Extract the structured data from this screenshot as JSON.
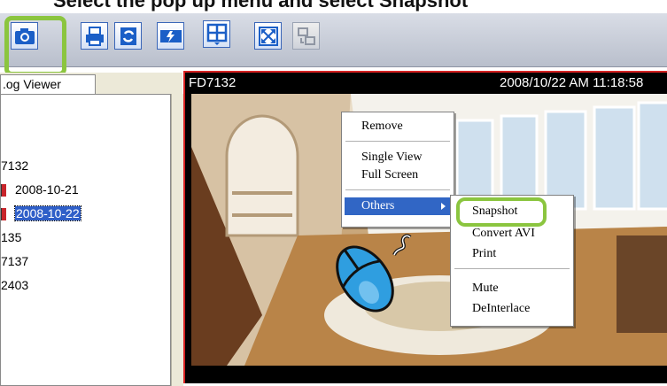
{
  "caption_fragment": "Select the pop up menu and select Snapshot",
  "toolbar": {
    "buttons": [
      {
        "name": "snapshot-button",
        "icon": "camera-icon"
      },
      {
        "name": "print-button",
        "icon": "printer-icon"
      },
      {
        "name": "refresh-button",
        "icon": "refresh-icon"
      },
      {
        "name": "lightning-button",
        "icon": "lightning-icon"
      },
      {
        "name": "layout-button",
        "icon": "grid-layout-icon"
      },
      {
        "name": "fullscreen-button",
        "icon": "fullscreen-icon"
      },
      {
        "name": "switch-disabled-button",
        "icon": "switch-icon"
      }
    ],
    "highlight_color": "#8bc53f"
  },
  "left_panel": {
    "tab_label": ".og Viewer",
    "items": [
      {
        "label": "7132",
        "icon": false,
        "selected": false
      },
      {
        "label": "2008-10-21",
        "icon": true,
        "selected": false
      },
      {
        "label": "2008-10-22",
        "icon": true,
        "selected": true
      },
      {
        "label": "135",
        "icon": false,
        "selected": false
      },
      {
        "label": "7137",
        "icon": false,
        "selected": false
      },
      {
        "label": "2403",
        "icon": false,
        "selected": false
      }
    ]
  },
  "video": {
    "camera_name": "FD7132",
    "timestamp": "2008/10/22 AM 11:18:58",
    "border_color": "#d62222"
  },
  "context_menu": {
    "remove": "Remove",
    "single_view": "Single View",
    "full_screen": "Full Screen",
    "others": "Others"
  },
  "submenu": {
    "snapshot": "Snapshot",
    "convert_avi": "Convert AVI",
    "print": "Print",
    "mute": "Mute",
    "deinterlace": "DeInterlace"
  }
}
